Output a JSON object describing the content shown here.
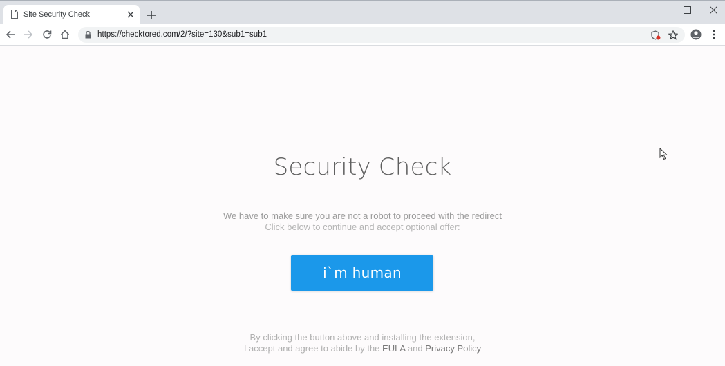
{
  "browser": {
    "tab": {
      "title": "Site Security Check",
      "icon": "document-icon"
    },
    "address": {
      "url": "https://checktored.com/2/?site=130&sub1=sub1"
    },
    "icons": [
      "back-icon",
      "forward-icon",
      "reload-icon",
      "home-icon",
      "lock-icon",
      "extension-icon",
      "star-icon",
      "profile-icon",
      "menu-icon",
      "minimize-icon",
      "maximize-icon",
      "close-icon",
      "new-tab-icon"
    ]
  },
  "page": {
    "heading": "Security Check",
    "line1": "We have to make sure you are not a robot to proceed with the redirect",
    "line2": "Click below to continue and accept optional offer:",
    "button_label": "i`m human",
    "footer": {
      "line1": "By clicking the button above and installing the extension,",
      "line2_prefix": "I accept and agree to abide by the",
      "eula": "EULA",
      "and": "and",
      "privacy": "Privacy Policy"
    }
  },
  "colors": {
    "accent": "#1b98ea",
    "page_bg": "#fdfbfc",
    "chrome_bg": "#dee1e6"
  }
}
